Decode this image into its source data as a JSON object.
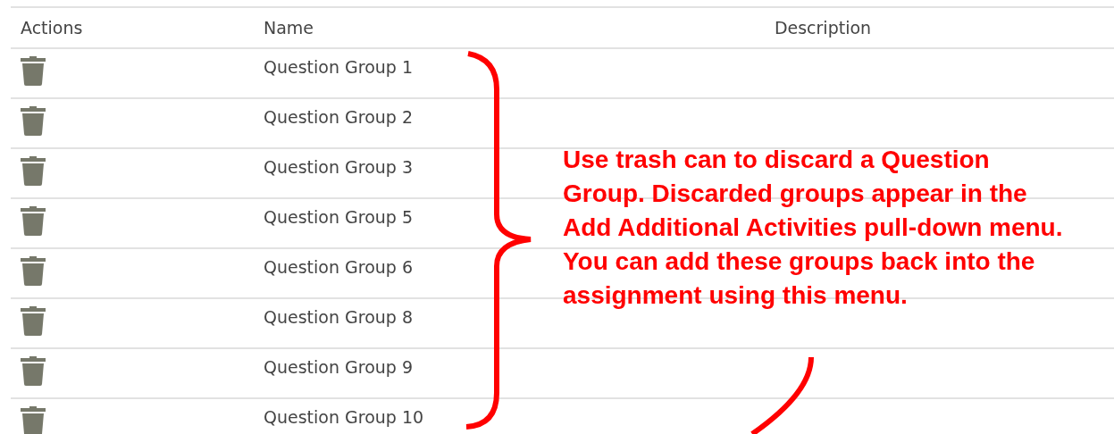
{
  "table": {
    "columns": [
      "Actions",
      "Name",
      "Description"
    ],
    "rows": [
      {
        "name": "Question Group 1"
      },
      {
        "name": "Question Group 2"
      },
      {
        "name": "Question Group 3"
      },
      {
        "name": "Question Group 5"
      },
      {
        "name": "Question Group 6"
      },
      {
        "name": "Question Group 8"
      },
      {
        "name": "Question Group 9"
      },
      {
        "name": "Question Group 10"
      }
    ]
  },
  "annotation": {
    "text": "Use trash can to discard a Question Group. Discarded groups appear in the Add Additional Activities pull-down menu. You can add these groups back into the assignment using this menu."
  }
}
